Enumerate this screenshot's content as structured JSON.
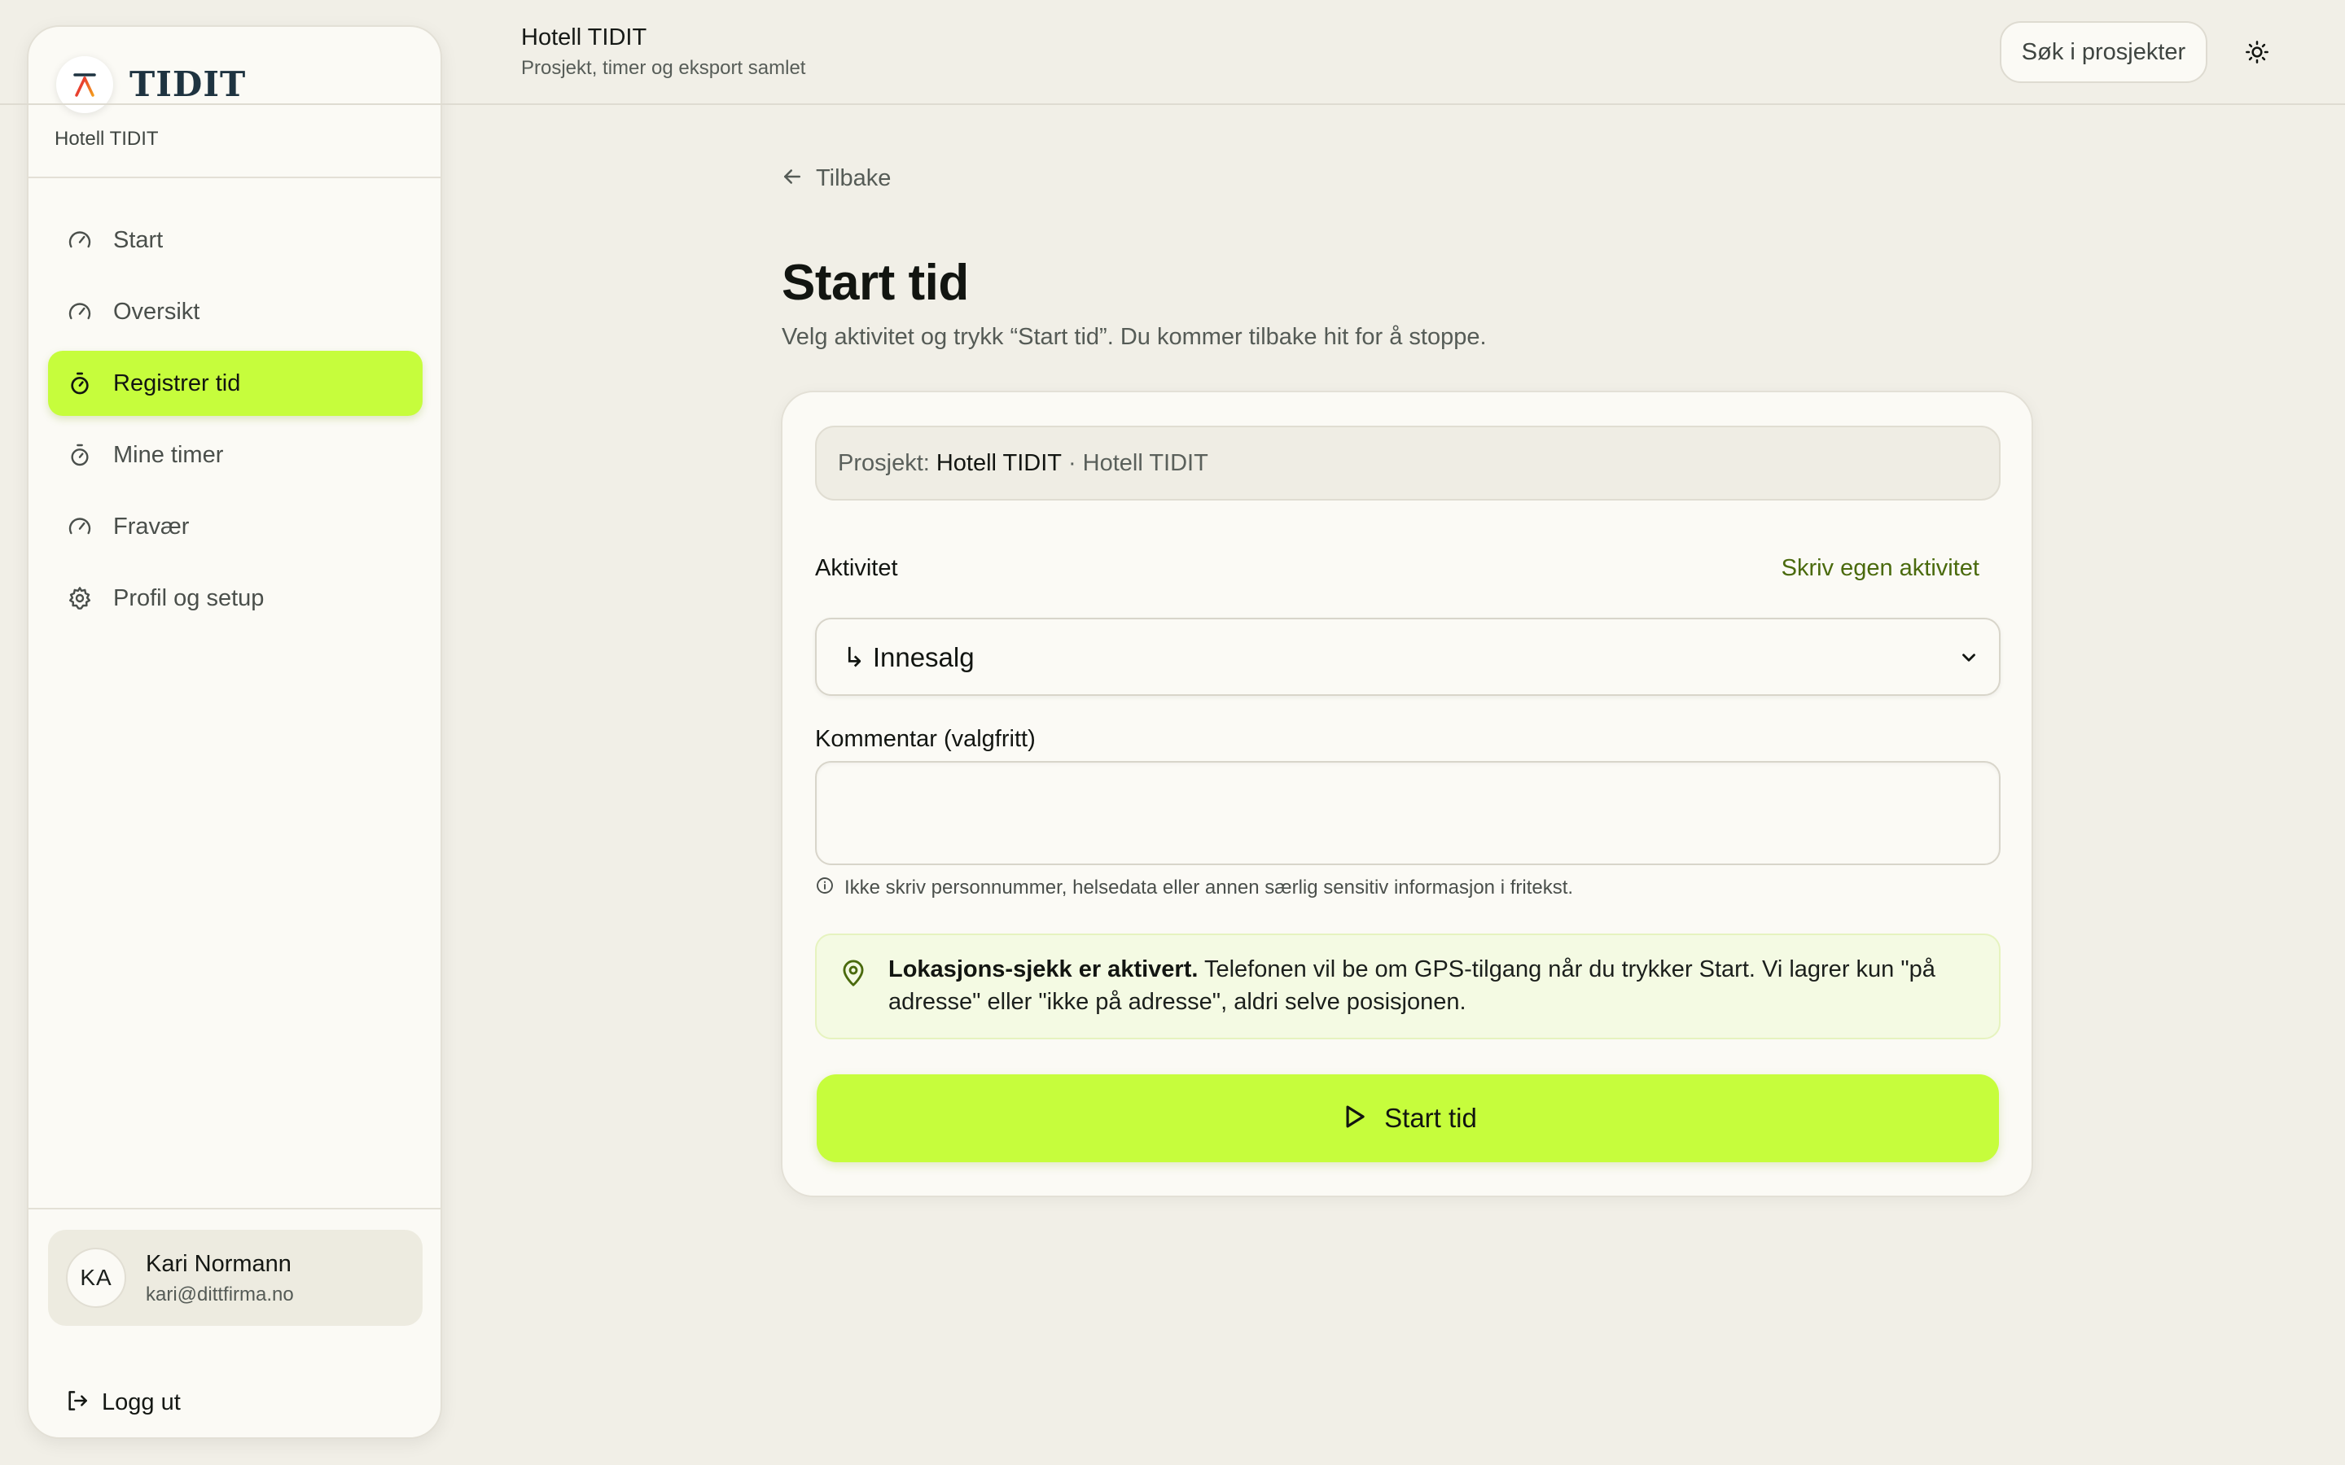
{
  "brand": {
    "name": "TIDIT",
    "workspace": "Hotell TIDIT"
  },
  "nav": {
    "items": [
      {
        "label": "Start",
        "icon": "gauge-icon"
      },
      {
        "label": "Oversikt",
        "icon": "gauge-icon"
      },
      {
        "label": "Registrer tid",
        "icon": "stopwatch-icon",
        "active": true
      },
      {
        "label": "Mine timer",
        "icon": "stopwatch-icon"
      },
      {
        "label": "Fravær",
        "icon": "gauge-icon"
      },
      {
        "label": "Profil og setup",
        "icon": "gear-icon"
      }
    ]
  },
  "user": {
    "initials": "KA",
    "name": "Kari Normann",
    "email": "kari@dittfirma.no"
  },
  "logout_label": "Logg ut",
  "topbar": {
    "title": "Hotell TIDIT",
    "subtitle": "Prosjekt, timer og eksport samlet",
    "search_label": "Søk i prosjekter",
    "theme_icon": "sun-icon"
  },
  "main": {
    "back_label": "Tilbake",
    "title": "Start tid",
    "subtitle": "Velg aktivitet og trykk “Start tid”. Du kommer tilbake hit for å stoppe.",
    "project": {
      "prefix": "Prosjekt:",
      "name": "Hotell TIDIT",
      "separator": "·",
      "customer": "Hotell TIDIT"
    },
    "activity": {
      "label": "Aktivitet",
      "custom_link": "Skriv egen aktivitet",
      "selected": "↳ Innesalg"
    },
    "comment": {
      "label": "Kommentar (valgfritt)",
      "value": "",
      "hint": "Ikke skriv personnummer, helsedata eller annen særlig sensitiv informasjon i fritekst."
    },
    "location_notice": {
      "bold": "Lokasjons-sjekk er aktivert.",
      "text": "Telefonen vil be om GPS-tilgang når du trykker Start. Vi lagrer kun \"på adresse\" eller \"ikke på adresse\", aldri selve posisjonen."
    },
    "start_button": "Start tid"
  },
  "colors": {
    "accent": "#c6fd3c",
    "background": "#f1efe7",
    "surface": "#fbfaf5",
    "link": "#4a6a0d",
    "notice_bg": "#f4fae3"
  }
}
